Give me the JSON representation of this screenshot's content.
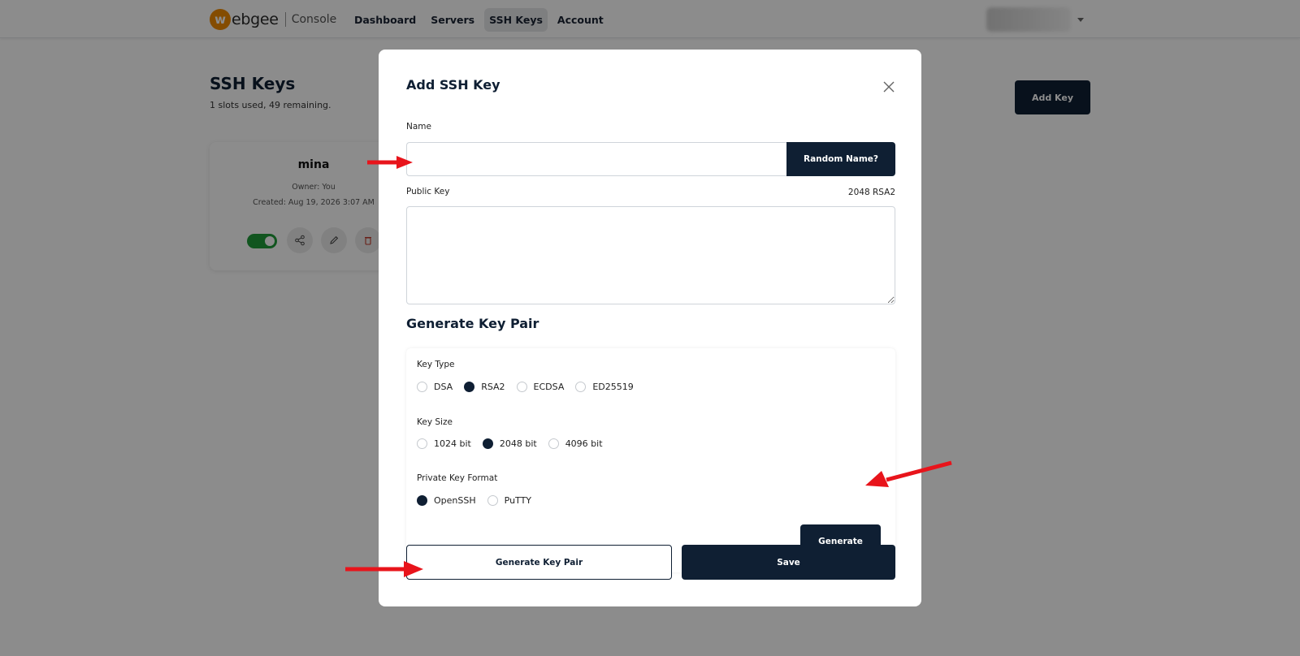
{
  "header": {
    "logo_letter": "w",
    "logo_word": "ebgee",
    "console_label": "Console",
    "nav": [
      {
        "label": "Dashboard",
        "active": false
      },
      {
        "label": "Servers",
        "active": false
      },
      {
        "label": "SSH Keys",
        "active": true
      },
      {
        "label": "Account",
        "active": false
      }
    ]
  },
  "page": {
    "title": "SSH Keys",
    "subtitle": "1 slots used, 49 remaining.",
    "add_key_label": "Add Key"
  },
  "key_card": {
    "name": "mina",
    "owner": "Owner: You",
    "created": "Created: Aug 19, 2026 3:07 AM",
    "enabled": true
  },
  "modal": {
    "title": "Add SSH Key",
    "name_label": "Name",
    "name_value": "",
    "random_name_label": "Random Name?",
    "public_key_label": "Public Key",
    "public_key_meta": "2048 RSA2",
    "public_key_value": "",
    "generate_section_title": "Generate Key Pair",
    "key_type_label": "Key Type",
    "key_types": [
      {
        "label": "DSA",
        "selected": false
      },
      {
        "label": "RSA2",
        "selected": true
      },
      {
        "label": "ECDSA",
        "selected": false
      },
      {
        "label": "ED25519",
        "selected": false
      }
    ],
    "key_size_label": "Key Size",
    "key_sizes": [
      {
        "label": "1024 bit",
        "selected": false
      },
      {
        "label": "2048 bit",
        "selected": true
      },
      {
        "label": "4096 bit",
        "selected": false
      }
    ],
    "format_label": "Private Key Format",
    "formats": [
      {
        "label": "OpenSSH",
        "selected": true
      },
      {
        "label": "PuTTY",
        "selected": false
      }
    ],
    "generate_label": "Generate",
    "generate_key_pair_label": "Generate Key Pair",
    "save_label": "Save"
  },
  "colors": {
    "primary": "#0f1f33",
    "accent_orange": "#f08a00",
    "toggle_green": "#1f9b3a",
    "annotation_red": "#e8141b"
  }
}
